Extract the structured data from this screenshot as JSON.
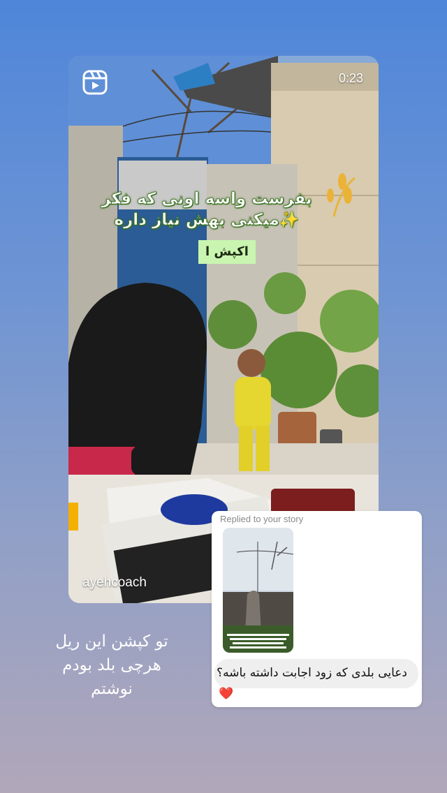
{
  "reel": {
    "duration": "0:23",
    "username": "ayehcoach",
    "overlay_text": "بفرست واسه اونی که فکر میکنی بهش نیاز داره✨",
    "overlay_tag": "اکپش ا",
    "icon": "reels-icon"
  },
  "reply": {
    "label": "Replied to your story",
    "message": "دعایی بلدی که زود اجابت داشته باشه؟",
    "reaction": "❤️"
  },
  "caption": {
    "line1": "تو کپشن این ریل",
    "line2": "هرچی بلد بودم",
    "line3": "نوشتم"
  },
  "colors": {
    "background_top": "#4f86d9",
    "background_bottom": "#b1a7b9",
    "tag_green": "#c9f5b0",
    "heart_red": "#e5243b"
  }
}
